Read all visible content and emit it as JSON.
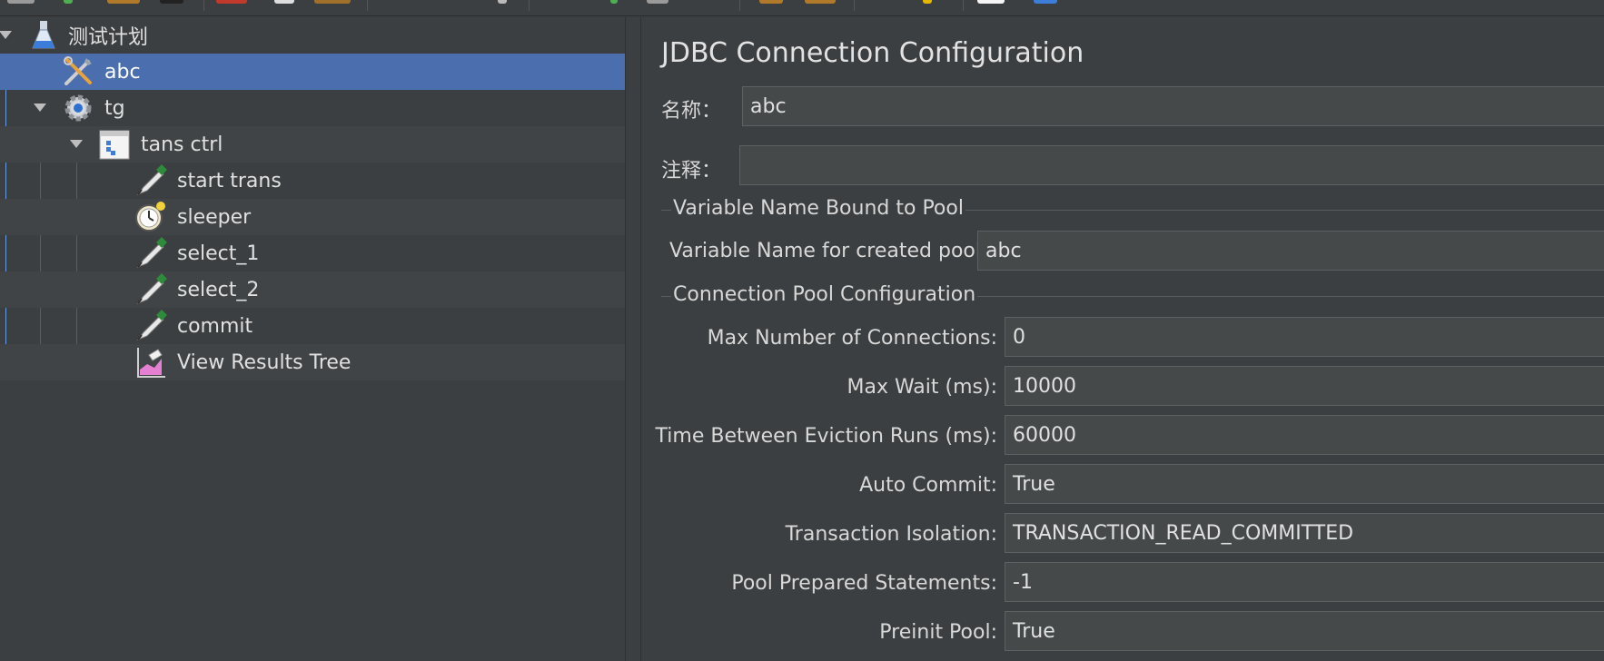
{
  "tree": {
    "items": [
      {
        "label": "测试计划",
        "icon": "test-plan-flask-icon"
      },
      {
        "label": "abc",
        "icon": "jdbc-config-tools-icon"
      },
      {
        "label": "tg",
        "icon": "thread-group-gear-icon"
      },
      {
        "label": "tans ctrl",
        "icon": "transaction-controller-icon"
      },
      {
        "label": "start trans",
        "icon": "jdbc-request-pen-icon"
      },
      {
        "label": "sleeper",
        "icon": "timer-stopwatch-icon"
      },
      {
        "label": "select_1",
        "icon": "jdbc-request-pen-icon"
      },
      {
        "label": "select_2",
        "icon": "jdbc-request-pen-icon"
      },
      {
        "label": "commit",
        "icon": "jdbc-request-pen-icon"
      },
      {
        "label": "View Results Tree",
        "icon": "listener-chart-icon"
      }
    ],
    "selected_index": 1
  },
  "panel": {
    "title": "JDBC Connection Configuration",
    "name_label": "名称：",
    "name_value": "abc",
    "comment_label": "注释：",
    "comment_value": "",
    "section_variable": "Variable Name Bound to Pool",
    "var_name_label": "Variable Name for created pool:",
    "var_name_value": "abc",
    "section_pool": "Connection Pool Configuration",
    "pool_fields": [
      {
        "label": "Max Number of Connections:",
        "value": "0"
      },
      {
        "label": "Max Wait (ms):",
        "value": "10000"
      },
      {
        "label": "Time Between Eviction Runs (ms):",
        "value": "60000"
      },
      {
        "label": "Auto Commit:",
        "value": "True"
      },
      {
        "label": "Transaction Isolation:",
        "value": "TRANSACTION_READ_COMMITTED"
      },
      {
        "label": "Pool Prepared Statements:",
        "value": "-1"
      },
      {
        "label": "Preinit Pool:",
        "value": "True"
      }
    ]
  },
  "colors": {
    "background": "#3c3f41",
    "selection": "#4b6eaf",
    "field_bg": "#45494a"
  }
}
